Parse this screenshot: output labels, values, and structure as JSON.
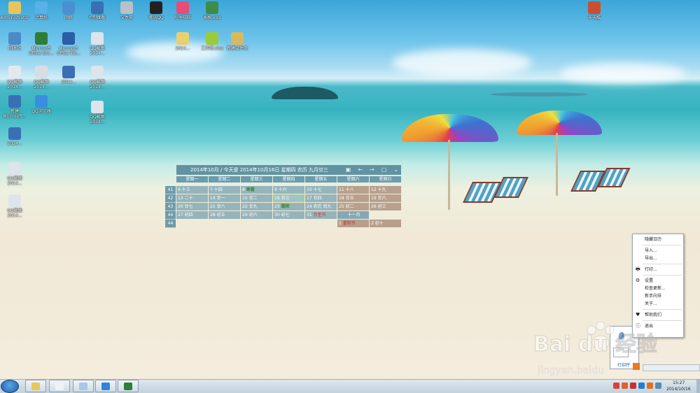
{
  "desktop_icons": [
    {
      "label": "Administrator",
      "color": "#e9c45a"
    },
    {
      "label": "计算机",
      "color": "#5ab0e8"
    },
    {
      "label": "网络",
      "color": "#4c8fd0"
    },
    {
      "label": "控制面板",
      "color": "#3b6fb5"
    },
    {
      "label": "文件夹",
      "color": "#b8c0c8"
    },
    {
      "label": "腾讯QQ",
      "color": "#222222"
    },
    {
      "label": "阿里旺旺",
      "color": "#e84c78"
    },
    {
      "label": "表格.xlsx",
      "color": "#3d8c4a"
    },
    {
      "label": "回收站",
      "color": "#4a8ac8"
    },
    {
      "label": "Microsoft Office Exc...",
      "color": "#2f7d3a"
    },
    {
      "label": "Microsoft Office Wo...",
      "color": "#2b5da8"
    },
    {
      "label": "QQ截图 2014...",
      "color": "#dde4ea"
    },
    {
      "label": "2014...",
      "color": "#e8d070"
    },
    {
      "label": "工作簿.xlsx",
      "color": "#9acb3a"
    },
    {
      "label": "新建文件夹",
      "color": "#d8b860"
    },
    {
      "label": "QQ截图 2014...",
      "color": "#e4e8ec"
    },
    {
      "label": "QQ截图 2014...",
      "color": "#d8dde2"
    },
    {
      "label": "2014...",
      "color": "#3b6fb5"
    },
    {
      "label": "QQ截图 2014...",
      "color": "#dde4ea"
    },
    {
      "label": "新建 Microsoft...",
      "color": "#3b6fb5"
    },
    {
      "label": "QQ浏览器",
      "color": "#3a8ee0"
    },
    {
      "label": "QQ截图 2014...",
      "color": "#dde4ea"
    },
    {
      "label": "2014...",
      "color": "#3b6fb5"
    },
    {
      "label": "QQ截图 2014...",
      "color": "#dde4ea"
    },
    {
      "label": "QQ截图 2014...",
      "color": "#dde4ea"
    },
    {
      "label": "天天酷",
      "color": "#c85030"
    }
  ],
  "calendar": {
    "title": "2014年10月 / 今天是 2014年10月16日 星期四 农历 九月廿三",
    "controls": [
      "▣",
      "←",
      "→",
      "▢",
      "⌄"
    ],
    "weekdays": [
      "星期一",
      "星期二",
      "星期三",
      "星期四",
      "星期五",
      "星期六",
      "星期日"
    ],
    "week_numbers": [
      "41",
      "42",
      "43",
      "44",
      "44"
    ],
    "cells": [
      {
        "d": "6",
        "l": "十三"
      },
      {
        "d": "7",
        "l": "十四"
      },
      {
        "d": "8",
        "l": "寒露",
        "hl": true
      },
      {
        "d": "9",
        "l": "十六"
      },
      {
        "d": "10",
        "l": "十七"
      },
      {
        "d": "11",
        "l": "十八",
        "we": true
      },
      {
        "d": "12",
        "l": "十九",
        "we": true
      },
      {
        "d": "13",
        "l": "二十"
      },
      {
        "d": "14",
        "l": "廿一"
      },
      {
        "d": "15",
        "l": "廿二"
      },
      {
        "d": "16",
        "l": "廿三",
        "today": true
      },
      {
        "d": "17",
        "l": "廿四"
      },
      {
        "d": "18",
        "l": "廿五",
        "we": true
      },
      {
        "d": "19",
        "l": "廿六",
        "we": true
      },
      {
        "d": "20",
        "l": "廿七"
      },
      {
        "d": "21",
        "l": "廿八"
      },
      {
        "d": "22",
        "l": "廿九"
      },
      {
        "d": "23",
        "l": "霜降",
        "hl": true
      },
      {
        "d": "24",
        "l": "农历 闰九"
      },
      {
        "d": "25",
        "l": "初二",
        "we": true
      },
      {
        "d": "26",
        "l": "初三",
        "we": true
      },
      {
        "d": "27",
        "l": "初四"
      },
      {
        "d": "28",
        "l": "初五"
      },
      {
        "d": "29",
        "l": "初六"
      },
      {
        "d": "30",
        "l": "初七"
      },
      {
        "d": "31",
        "l": "万圣节",
        "red": true
      },
      {
        "d": "",
        "l": "十一月",
        "month": true
      },
      {
        "d": "",
        "l": "",
        "empty": true
      },
      {
        "d": "",
        "l": "",
        "empty": true
      },
      {
        "d": "",
        "l": "",
        "empty": true
      },
      {
        "d": "",
        "l": "",
        "empty": true
      },
      {
        "d": "",
        "l": "",
        "empty": true
      },
      {
        "d": "",
        "l": "",
        "empty": true
      },
      {
        "d": "1",
        "l": "重阳节",
        "red": true,
        "we": true
      },
      {
        "d": "2",
        "l": "初十",
        "we": true
      }
    ]
  },
  "context_menu": {
    "items": [
      {
        "label": "隐藏日历",
        "icon": ""
      },
      {
        "sep": true
      },
      {
        "label": "导入...",
        "icon": ""
      },
      {
        "label": "导出...",
        "icon": ""
      },
      {
        "sep": true
      },
      {
        "label": "打印...",
        "icon": "🖶"
      },
      {
        "sep": true
      },
      {
        "label": "设置",
        "icon": "⚙"
      },
      {
        "label": "检查更新...",
        "icon": ""
      },
      {
        "label": "新手向导",
        "icon": ""
      },
      {
        "label": "关于...",
        "icon": ""
      },
      {
        "sep": true
      },
      {
        "label": "帮助我们",
        "icon": "♥"
      },
      {
        "sep": true
      },
      {
        "label": "退出",
        "icon": "ⓘ"
      }
    ]
  },
  "tray_popup": {
    "label": "打招呼"
  },
  "watermark": {
    "text": "Bai du 经验",
    "url": "jingyan.baidu"
  },
  "taskbar": {
    "buttons": [
      {
        "name": "explorer",
        "color": "#e8c85a"
      },
      {
        "name": "mouse",
        "color": "#f2f2f2"
      },
      {
        "name": "paint",
        "color": "#a8c8e8"
      },
      {
        "name": "qq-browser",
        "color": "#2f86d8"
      },
      {
        "name": "excel",
        "color": "#2f7d3a"
      }
    ],
    "time": "15:27",
    "date": "2014/10/16"
  }
}
